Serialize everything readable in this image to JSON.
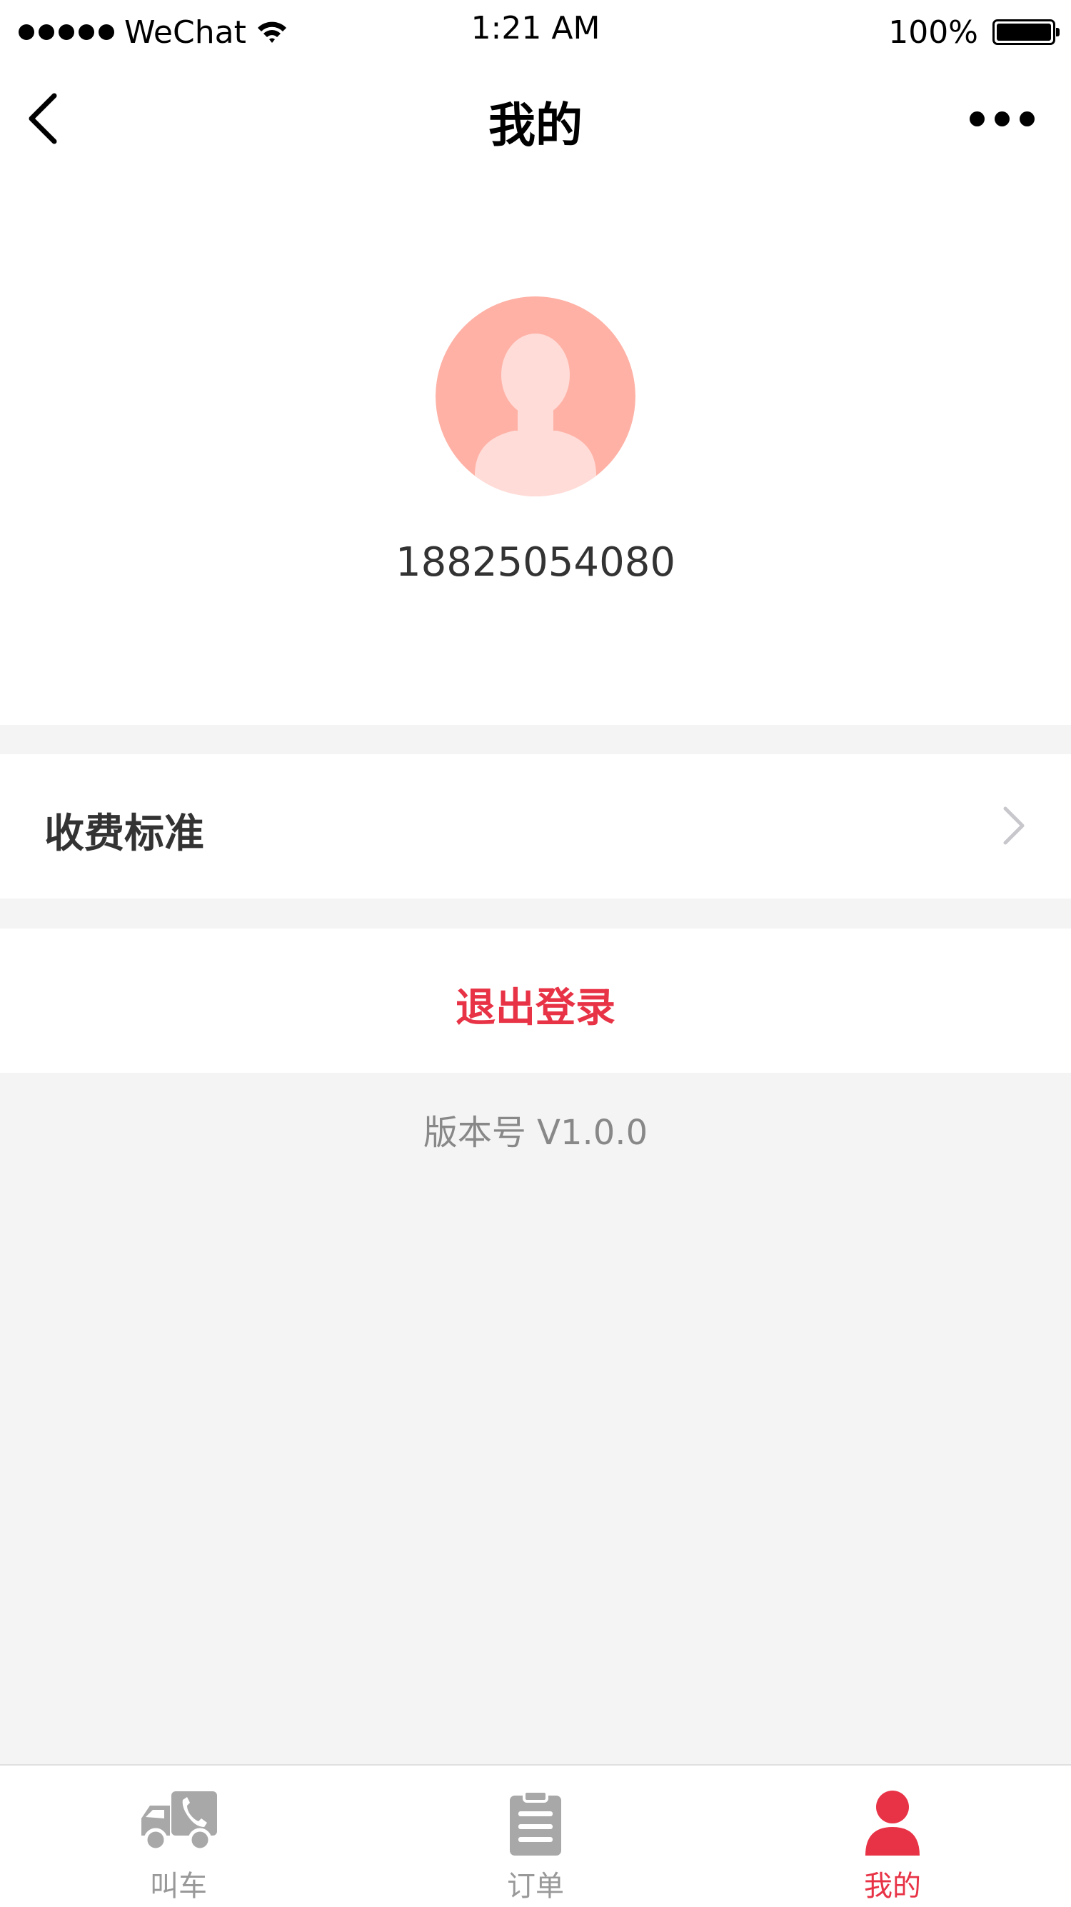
{
  "status_bar": {
    "carrier": "WeChat",
    "time": "1:21 AM",
    "battery": "100%"
  },
  "nav": {
    "title": "我的"
  },
  "profile": {
    "phone": "18825054080"
  },
  "menu": {
    "fee_standard": "收费标准"
  },
  "logout": {
    "label": "退出登录"
  },
  "version": "版本号 V1.0.0",
  "tabs": [
    {
      "label": "叫车",
      "icon": "truck-phone-icon",
      "active": false
    },
    {
      "label": "订单",
      "icon": "clipboard-icon",
      "active": false
    },
    {
      "label": "我的",
      "icon": "person-icon",
      "active": true
    }
  ],
  "colors": {
    "accent": "#e83346",
    "avatar_bg": "#ffb1a5",
    "page_bg": "#f4f4f4",
    "inactive_tab": "#a8a8a8"
  }
}
